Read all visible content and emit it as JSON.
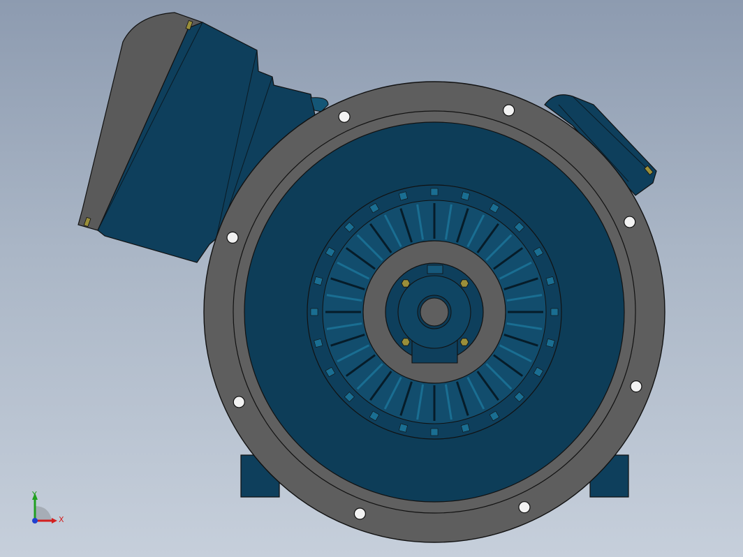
{
  "viewport": {
    "background_top": "#8d9bb0",
    "background_bottom": "#c6cfdb"
  },
  "model": {
    "flange_color": "#5e5e5e",
    "body_color": "#0c3e5a",
    "body_highlight": "#1a6e92",
    "edge_color": "#111111",
    "bolt_color": "#9a8f3a",
    "flange_holes": 8,
    "fan_blades": 40
  },
  "triad": {
    "x_label": "X",
    "y_label": "Y",
    "x_color": "#d32020",
    "y_color": "#20a020",
    "z_color": "#2040d0"
  }
}
